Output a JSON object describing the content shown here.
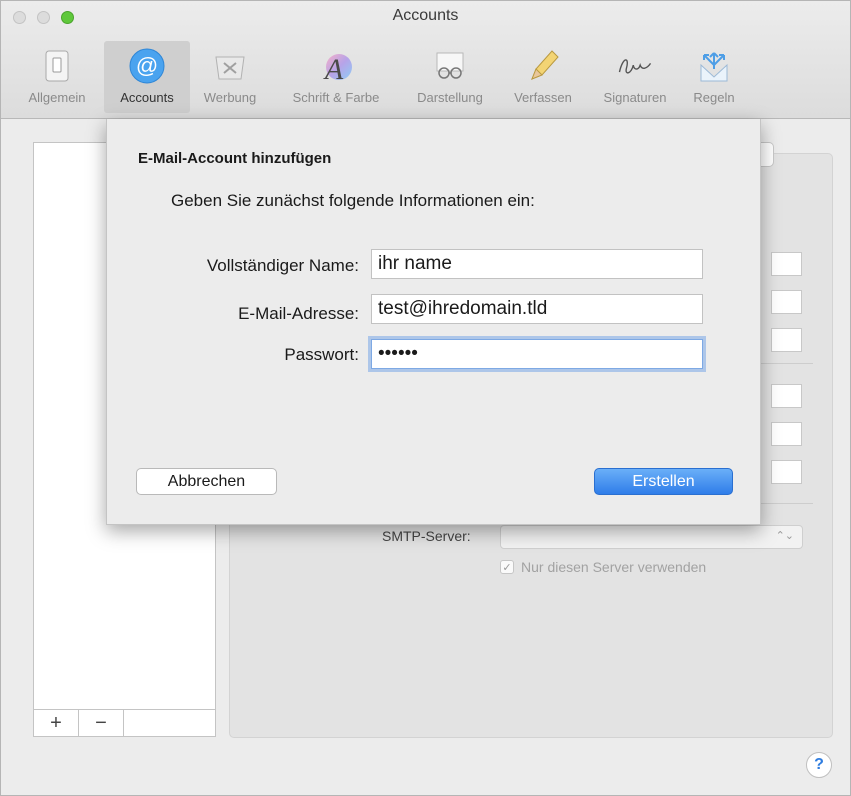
{
  "window": {
    "title": "Accounts"
  },
  "toolbar": {
    "items": [
      {
        "label": "Allgemein",
        "icon": "switch-icon"
      },
      {
        "label": "Accounts",
        "icon": "at-icon"
      },
      {
        "label": "Werbung",
        "icon": "junk-tray-icon"
      },
      {
        "label": "Schrift & Farbe",
        "icon": "font-color-icon"
      },
      {
        "label": "Darstellung",
        "icon": "glasses-icon"
      },
      {
        "label": "Verfassen",
        "icon": "pencil-icon"
      },
      {
        "label": "Signaturen",
        "icon": "signature-icon"
      },
      {
        "label": "Regeln",
        "icon": "rules-arrows-icon"
      }
    ],
    "selected": "Accounts"
  },
  "list_footer": {
    "add": "+",
    "remove": "−"
  },
  "background_form": {
    "smtp_label": "SMTP-Server:",
    "only_server_label": "Nur diesen Server verwenden",
    "only_server_checked": true
  },
  "dialog": {
    "title": "E-Mail-Account hinzufügen",
    "subtitle": "Geben Sie zunächst folgende Informationen ein:",
    "fields": {
      "name_label": "Vollständiger Name:",
      "name_value": "ihr name",
      "email_label": "E-Mail-Adresse:",
      "email_value": "test@ihredomain.tld",
      "password_label": "Passwort:",
      "password_value": "••••••"
    },
    "cancel_label": "Abbrechen",
    "create_label": "Erstellen"
  },
  "help": {
    "label": "?"
  },
  "colors": {
    "accent": "#2f7de9",
    "zoom_button": "#5fc83b"
  }
}
